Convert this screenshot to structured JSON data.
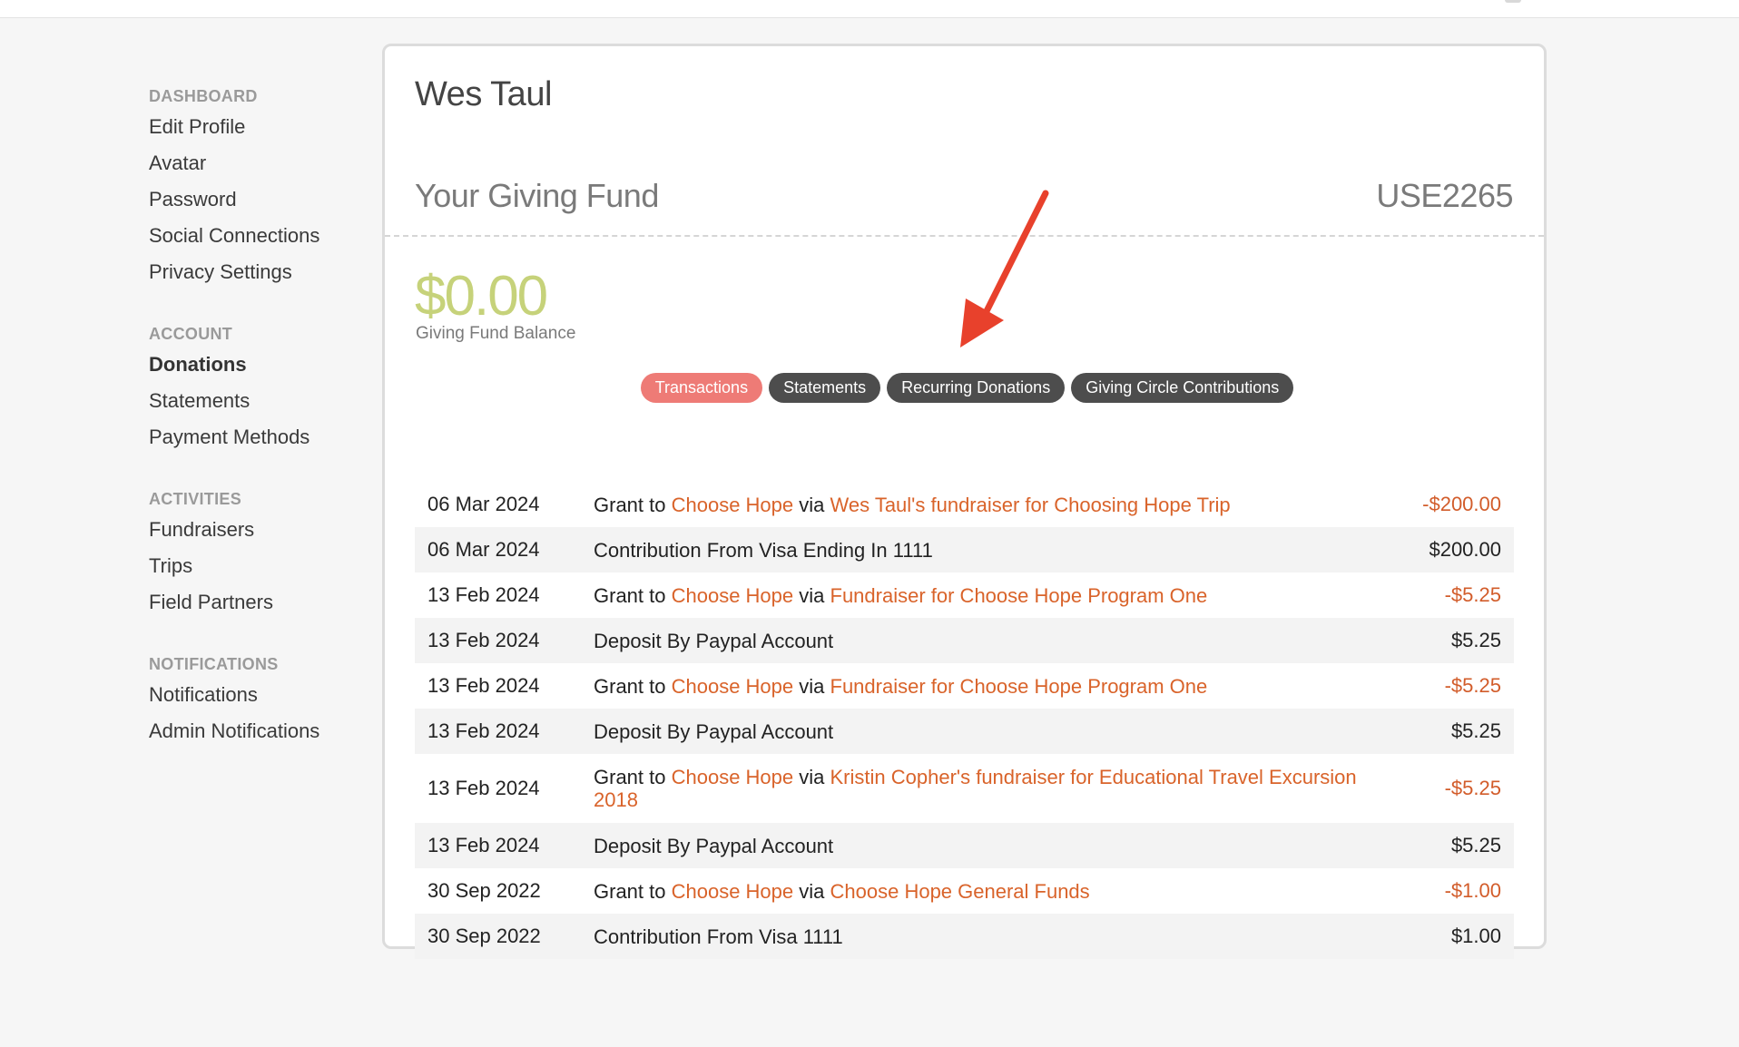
{
  "sidebar": {
    "sections": [
      {
        "heading": "DASHBOARD",
        "items": [
          "Edit Profile",
          "Avatar",
          "Password",
          "Social Connections",
          "Privacy Settings"
        ]
      },
      {
        "heading": "ACCOUNT",
        "items": [
          "Donations",
          "Statements",
          "Payment Methods"
        ]
      },
      {
        "heading": "ACTIVITIES",
        "items": [
          "Fundraisers",
          "Trips",
          "Field Partners"
        ]
      },
      {
        "heading": "NOTIFICATIONS",
        "items": [
          "Notifications",
          "Admin Notifications"
        ]
      }
    ],
    "active_item": "Donations"
  },
  "profile": {
    "name": "Wes Taul"
  },
  "fund": {
    "title": "Your Giving Fund",
    "id": "USE2265",
    "balance": "$0.00",
    "balance_label": "Giving Fund Balance"
  },
  "tabs": [
    {
      "label": "Transactions",
      "active": true
    },
    {
      "label": "Statements",
      "active": false
    },
    {
      "label": "Recurring Donations",
      "active": false
    },
    {
      "label": "Giving Circle Contributions",
      "active": false
    }
  ],
  "transactions": [
    {
      "date": "06 Mar 2024",
      "type": "grant",
      "prefix": "Grant to ",
      "recipient": "Choose Hope",
      "via": " via ",
      "campaign": "Wes Taul's fundraiser for Choosing Hope Trip",
      "amount": "-$200.00",
      "negative": true
    },
    {
      "date": "06 Mar 2024",
      "type": "plain",
      "text": "Contribution From Visa Ending In 1111",
      "amount": "$200.00",
      "negative": false
    },
    {
      "date": "13 Feb 2024",
      "type": "grant",
      "prefix": "Grant to ",
      "recipient": "Choose Hope",
      "via": " via ",
      "campaign": "Fundraiser for Choose Hope Program One",
      "amount": "-$5.25",
      "negative": true
    },
    {
      "date": "13 Feb 2024",
      "type": "plain",
      "text": "Deposit By Paypal Account",
      "amount": "$5.25",
      "negative": false
    },
    {
      "date": "13 Feb 2024",
      "type": "grant",
      "prefix": "Grant to ",
      "recipient": "Choose Hope",
      "via": " via ",
      "campaign": "Fundraiser for Choose Hope Program One",
      "amount": "-$5.25",
      "negative": true
    },
    {
      "date": "13 Feb 2024",
      "type": "plain",
      "text": "Deposit By Paypal Account",
      "amount": "$5.25",
      "negative": false
    },
    {
      "date": "13 Feb 2024",
      "type": "grant",
      "prefix": "Grant to ",
      "recipient": "Choose Hope",
      "via": " via ",
      "campaign": "Kristin Copher's fundraiser for Educational Travel Excursion 2018",
      "amount": "-$5.25",
      "negative": true
    },
    {
      "date": "13 Feb 2024",
      "type": "plain",
      "text": "Deposit By Paypal Account",
      "amount": "$5.25",
      "negative": false
    },
    {
      "date": "30 Sep 2022",
      "type": "grant",
      "prefix": "Grant to ",
      "recipient": "Choose Hope",
      "via": " via ",
      "campaign": "Choose Hope General Funds",
      "amount": "-$1.00",
      "negative": true
    },
    {
      "date": "30 Sep 2022",
      "type": "plain",
      "text": "Contribution From Visa 1111",
      "amount": "$1.00",
      "negative": false
    }
  ],
  "colors": {
    "accent_tab": "#ee7b76",
    "link": "#d9632a",
    "balance": "#c6d27a",
    "annotation_arrow": "#e8412c"
  },
  "icons": {
    "annotation": "red-arrow-icon"
  }
}
